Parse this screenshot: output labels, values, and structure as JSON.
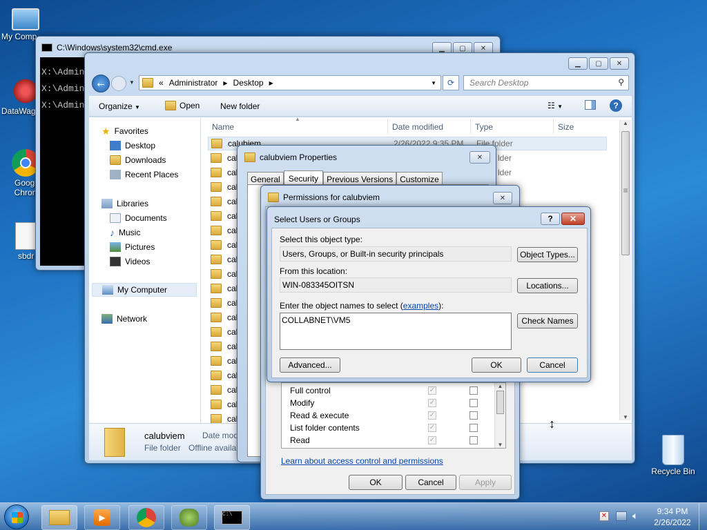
{
  "desktop": {
    "icons": [
      {
        "label": "My Comp"
      },
      {
        "label": "DataWag"
      },
      {
        "label": "Googl\nChron"
      },
      {
        "label": "sbdr"
      },
      {
        "label": "Recycle Bin"
      }
    ]
  },
  "cmd": {
    "title": "C:\\Windows\\system32\\cmd.exe",
    "lines": [
      "X:\\Admin",
      "X:\\Admin",
      "X:\\Admin"
    ]
  },
  "explorer": {
    "breadcrumb": [
      "Administrator",
      "Desktop"
    ],
    "breadcrumb_prefix": "«",
    "search_placeholder": "Search Desktop",
    "toolbar": {
      "organize": "Organize",
      "open": "Open",
      "new_folder": "New folder"
    },
    "nav": {
      "favorites": "Favorites",
      "fav_items": [
        "Desktop",
        "Downloads",
        "Recent Places"
      ],
      "libraries": "Libraries",
      "lib_items": [
        "Documents",
        "Music",
        "Pictures",
        "Videos"
      ],
      "computer": "My Computer",
      "network": "Network"
    },
    "columns": {
      "name": "Name",
      "date": "Date modified",
      "type": "Type",
      "size": "Size"
    },
    "first_row": {
      "name": "calubiem",
      "date": "2/26/2022 9:35 PM",
      "type": "File folder"
    },
    "row_prefix": "cal",
    "type_partial": "lder",
    "details": {
      "name": "calubviem",
      "type": "File folder",
      "date_label": "Date mod",
      "offline": "Offline availab"
    }
  },
  "properties": {
    "title": "calubviem Properties",
    "tabs": [
      "General",
      "Security",
      "Previous Versions",
      "Customize"
    ]
  },
  "permissions": {
    "title": "Permissions for calubviem",
    "rows": [
      "Full control",
      "Modify",
      "Read & execute",
      "List folder contents",
      "Read"
    ],
    "link": "Learn about access control and permissions",
    "ok": "OK",
    "cancel": "Cancel",
    "apply": "Apply"
  },
  "select_dialog": {
    "title": "Select Users or Groups",
    "help": "?",
    "object_type_label": "Select this object type:",
    "object_type_value": "Users, Groups, or Built-in security principals",
    "object_types_btn": "Object Types...",
    "location_label": "From this location:",
    "location_value": "WIN-083345OITSN",
    "locations_btn": "Locations...",
    "names_label_pre": "Enter the object names to select (",
    "names_label_link": "examples",
    "names_label_post": "):",
    "names_value": "COLLABNET\\VM5",
    "check_names_btn": "Check Names",
    "advanced_btn": "Advanced...",
    "ok_btn": "OK",
    "cancel_btn": "Cancel"
  },
  "taskbar": {
    "time": "9:34 PM",
    "date": "2/26/2022"
  }
}
